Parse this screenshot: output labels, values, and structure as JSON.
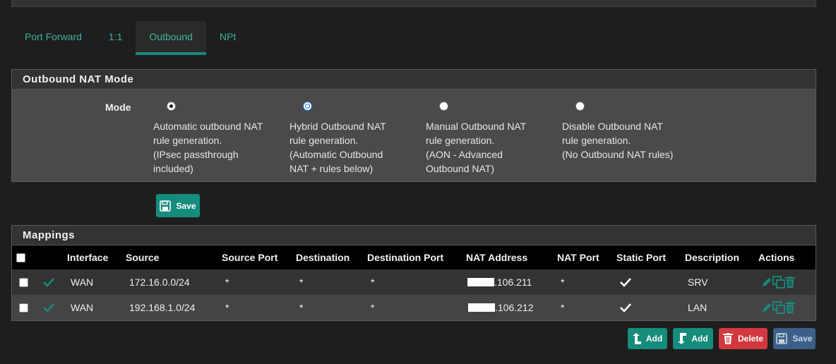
{
  "tabs": [
    {
      "label": "Port Forward"
    },
    {
      "label": "1:1"
    },
    {
      "label": "Outbound"
    },
    {
      "label": "NPt"
    }
  ],
  "mode_panel": {
    "title": "Outbound NAT Mode",
    "mode_label": "Mode",
    "options": [
      {
        "lines": [
          "Automatic outbound NAT",
          "rule generation.",
          "(IPsec passthrough",
          "included)"
        ],
        "checked": true
      },
      {
        "lines": [
          "Hybrid Outbound NAT",
          "rule generation.",
          "(Automatic Outbound",
          "NAT + rules below)"
        ],
        "checked": false
      },
      {
        "lines": [
          "Manual Outbound NAT",
          "rule generation.",
          "(AON - Advanced",
          "Outbound NAT)"
        ],
        "checked": false
      },
      {
        "lines": [
          "Disable Outbound NAT",
          "rule generation.",
          "(No Outbound NAT rules)"
        ],
        "checked": false
      }
    ],
    "save_label": "Save"
  },
  "mappings": {
    "title": "Mappings",
    "columns": [
      "Interface",
      "Source",
      "Source Port",
      "Destination",
      "Destination Port",
      "NAT Address",
      "NAT Port",
      "Static Port",
      "Description",
      "Actions"
    ],
    "rows": [
      {
        "interface": "WAN",
        "source": "172.16.0.0/24",
        "source_port": "*",
        "destination": "*",
        "destination_port": "*",
        "nat_address": ".106.211",
        "nat_port": "*",
        "description": "SRV"
      },
      {
        "interface": "WAN",
        "source": "192.168.1.0/24",
        "source_port": "*",
        "destination": "*",
        "destination_port": "*",
        "nat_address": ".106.212",
        "nat_port": "*",
        "description": "LAN"
      }
    ]
  },
  "bottom_buttons": {
    "add_top": "Add",
    "add_bottom": "Add",
    "delete": "Delete",
    "save": "Save"
  },
  "colors": {
    "accent": "#158c7c",
    "danger": "#d3383e",
    "save_blue": "#3b5f88"
  }
}
